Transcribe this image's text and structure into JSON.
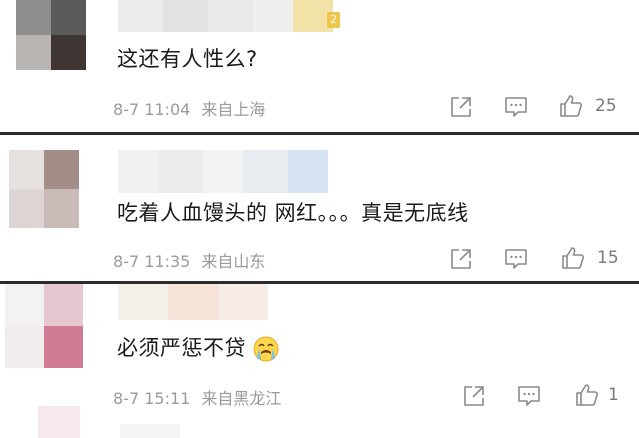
{
  "comments": [
    {
      "text": "这还有人性么?",
      "time": "8-7 11:04",
      "location": "来自上海",
      "likes": "25",
      "badge": "2"
    },
    {
      "text": "吃着人血馒头的 网红。。。真是无底线",
      "time": "8-7 11:35",
      "location": "来自山东",
      "likes": "15"
    },
    {
      "text": "必须严惩不贷",
      "time": "8-7 15:11",
      "location": "来自黑龙江",
      "likes": "1"
    }
  ],
  "colors": {
    "divider": "#2b2b2b",
    "text": "#1a1a1a",
    "meta": "#9a9a9a",
    "icon": "#8a8a8a"
  },
  "icons": [
    "share-icon",
    "comment-icon",
    "like-icon",
    "emoji-crying-icon"
  ]
}
